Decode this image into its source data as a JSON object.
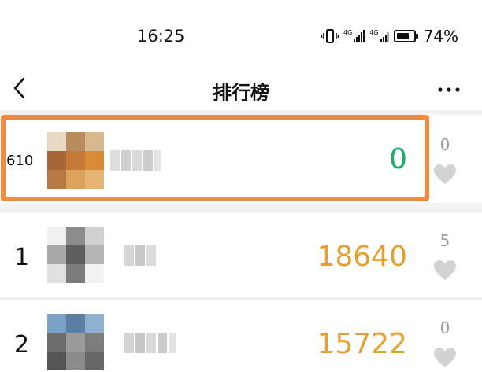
{
  "status_bar": {
    "time": "16:25",
    "network_tags": [
      "4G",
      "4G"
    ],
    "battery_percent": "74%",
    "battery_level": 0.74
  },
  "nav": {
    "title": "排行榜",
    "back_icon": "chevron-left-icon",
    "more_icon": "more-horizontal-icon"
  },
  "my_rank": {
    "rank": "610",
    "score": "0",
    "likes": "0"
  },
  "ranks": [
    {
      "rank": "1",
      "score": "18640",
      "likes": "5"
    },
    {
      "rank": "2",
      "score": "15722",
      "likes": "0"
    }
  ],
  "colors": {
    "highlight": "#f5893d",
    "score_self": "#16b06a",
    "score_others": "#e6a030",
    "like_gray": "#9b9b9b"
  }
}
